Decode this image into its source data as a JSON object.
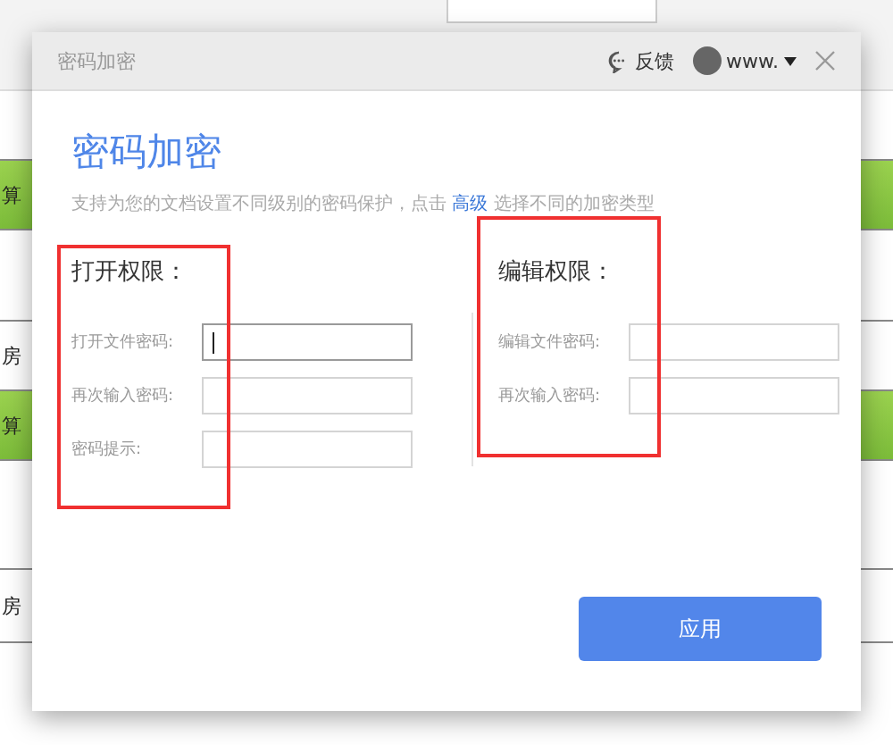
{
  "background": {
    "row_labels": [
      "算",
      "房",
      "算",
      "房"
    ]
  },
  "dialog": {
    "title": "密码加密",
    "feedback": "反馈",
    "account": "www.",
    "heading": "密码加密",
    "description": {
      "before": "支持为您的文档设置不同级别的密码保护，点击",
      "link": "高级",
      "after": "选择不同的加密类型"
    },
    "sections": [
      {
        "title": "打开权限：",
        "fields": [
          {
            "label": "打开文件密码:",
            "focused": true
          },
          {
            "label": "再次输入密码:",
            "focused": false
          },
          {
            "label": "密码提示:",
            "focused": false
          }
        ]
      },
      {
        "title": "编辑权限：",
        "fields": [
          {
            "label": "编辑文件密码:",
            "focused": false
          },
          {
            "label": "再次输入密码:",
            "focused": false
          }
        ]
      }
    ],
    "apply_button": "应用"
  }
}
